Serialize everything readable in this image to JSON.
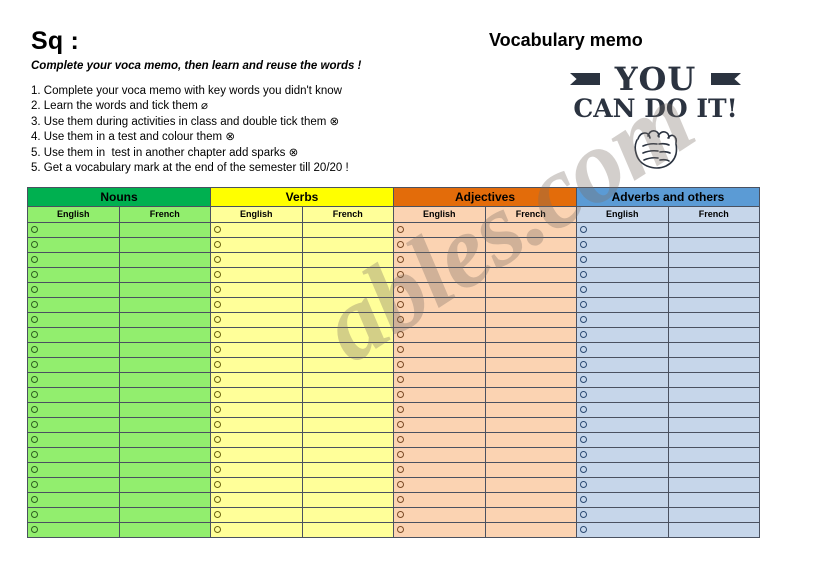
{
  "header": {
    "left_title": "Sq :",
    "right_title": "Vocabulary memo",
    "subtitle": "Complete your voca memo, then learn and reuse the words !",
    "steps": [
      "1. Complete your voca memo with key words you didn't know",
      "2. Learn the words and tick them ⌀",
      "3. Use them during activities in class and double tick them ⊗",
      "4. Use them in a test and colour them ⊗",
      "5. Use them in  test in another chapter add sparks ⊗",
      "5. Get a vocabulary mark at the end of the semester till 20/20 !"
    ]
  },
  "logo": {
    "line1": "YOU",
    "line2": "CAN DO IT!",
    "icon": "fist-icon"
  },
  "table": {
    "groups": [
      {
        "label": "Nouns",
        "key": "nouns",
        "header_color": "#00B050",
        "body_color": "#92EE6E"
      },
      {
        "label": "Verbs",
        "key": "verbs",
        "header_color": "#FFFF00",
        "body_color": "#FFFF99"
      },
      {
        "label": "Adjectives",
        "key": "adjectives",
        "header_color": "#E36C0A",
        "body_color": "#FBD3B2"
      },
      {
        "label": "Adverbs and others",
        "key": "adverbs",
        "header_color": "#5B9BD5",
        "body_color": "#C6D6EA"
      }
    ],
    "sub_headers": [
      "English",
      "French"
    ],
    "row_count": 21,
    "rows": [
      {
        "nouns_english": "",
        "nouns_french": "",
        "verbs_english": "",
        "verbs_french": "",
        "adjectives_english": "",
        "adjectives_french": "",
        "adverbs_english": "",
        "adverbs_french": ""
      },
      {
        "nouns_english": "",
        "nouns_french": "",
        "verbs_english": "",
        "verbs_french": "",
        "adjectives_english": "",
        "adjectives_french": "",
        "adverbs_english": "",
        "adverbs_french": ""
      },
      {
        "nouns_english": "",
        "nouns_french": "",
        "verbs_english": "",
        "verbs_french": "",
        "adjectives_english": "",
        "adjectives_french": "",
        "adverbs_english": "",
        "adverbs_french": ""
      },
      {
        "nouns_english": "",
        "nouns_french": "",
        "verbs_english": "",
        "verbs_french": "",
        "adjectives_english": "",
        "adjectives_french": "",
        "adverbs_english": "",
        "adverbs_french": ""
      },
      {
        "nouns_english": "",
        "nouns_french": "",
        "verbs_english": "",
        "verbs_french": "",
        "adjectives_english": "",
        "adjectives_french": "",
        "adverbs_english": "",
        "adverbs_french": ""
      },
      {
        "nouns_english": "",
        "nouns_french": "",
        "verbs_english": "",
        "verbs_french": "",
        "adjectives_english": "",
        "adjectives_french": "",
        "adverbs_english": "",
        "adverbs_french": ""
      },
      {
        "nouns_english": "",
        "nouns_french": "",
        "verbs_english": "",
        "verbs_french": "",
        "adjectives_english": "",
        "adjectives_french": "",
        "adverbs_english": "",
        "adverbs_french": ""
      },
      {
        "nouns_english": "",
        "nouns_french": "",
        "verbs_english": "",
        "verbs_french": "",
        "adjectives_english": "",
        "adjectives_french": "",
        "adverbs_english": "",
        "adverbs_french": ""
      },
      {
        "nouns_english": "",
        "nouns_french": "",
        "verbs_english": "",
        "verbs_french": "",
        "adjectives_english": "",
        "adjectives_french": "",
        "adverbs_english": "",
        "adverbs_french": ""
      },
      {
        "nouns_english": "",
        "nouns_french": "",
        "verbs_english": "",
        "verbs_french": "",
        "adjectives_english": "",
        "adjectives_french": "",
        "adverbs_english": "",
        "adverbs_french": ""
      },
      {
        "nouns_english": "",
        "nouns_french": "",
        "verbs_english": "",
        "verbs_french": "",
        "adjectives_english": "",
        "adjectives_french": "",
        "adverbs_english": "",
        "adverbs_french": ""
      },
      {
        "nouns_english": "",
        "nouns_french": "",
        "verbs_english": "",
        "verbs_french": "",
        "adjectives_english": "",
        "adjectives_french": "",
        "adverbs_english": "",
        "adverbs_french": ""
      },
      {
        "nouns_english": "",
        "nouns_french": "",
        "verbs_english": "",
        "verbs_french": "",
        "adjectives_english": "",
        "adjectives_french": "",
        "adverbs_english": "",
        "adverbs_french": ""
      },
      {
        "nouns_english": "",
        "nouns_french": "",
        "verbs_english": "",
        "verbs_french": "",
        "adjectives_english": "",
        "adjectives_french": "",
        "adverbs_english": "",
        "adverbs_french": ""
      },
      {
        "nouns_english": "",
        "nouns_french": "",
        "verbs_english": "",
        "verbs_french": "",
        "adjectives_english": "",
        "adjectives_french": "",
        "adverbs_english": "",
        "adverbs_french": ""
      },
      {
        "nouns_english": "",
        "nouns_french": "",
        "verbs_english": "",
        "verbs_french": "",
        "adjectives_english": "",
        "adjectives_french": "",
        "adverbs_english": "",
        "adverbs_french": ""
      },
      {
        "nouns_english": "",
        "nouns_french": "",
        "verbs_english": "",
        "verbs_french": "",
        "adjectives_english": "",
        "adjectives_french": "",
        "adverbs_english": "",
        "adverbs_french": ""
      },
      {
        "nouns_english": "",
        "nouns_french": "",
        "verbs_english": "",
        "verbs_french": "",
        "adjectives_english": "",
        "adjectives_french": "",
        "adverbs_english": "",
        "adverbs_french": ""
      },
      {
        "nouns_english": "",
        "nouns_french": "",
        "verbs_english": "",
        "verbs_french": "",
        "adjectives_english": "",
        "adjectives_french": "",
        "adverbs_english": "",
        "adverbs_french": ""
      },
      {
        "nouns_english": "",
        "nouns_french": "",
        "verbs_english": "",
        "verbs_french": "",
        "adjectives_english": "",
        "adjectives_french": "",
        "adverbs_english": "",
        "adverbs_french": ""
      },
      {
        "nouns_english": "",
        "nouns_french": "",
        "verbs_english": "",
        "verbs_french": "",
        "adjectives_english": "",
        "adjectives_french": "",
        "adverbs_english": "",
        "adverbs_french": ""
      }
    ]
  },
  "watermark": {
    "text": "ables.com"
  }
}
